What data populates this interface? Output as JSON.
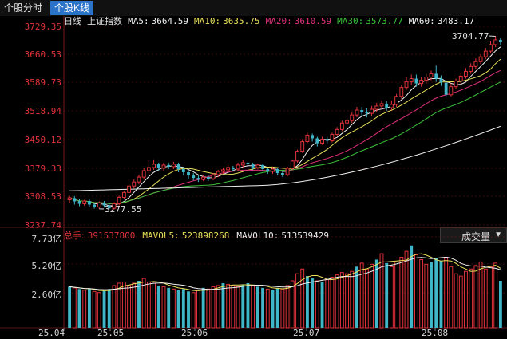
{
  "tabs": [
    {
      "label": "个股分时",
      "active": false
    },
    {
      "label": "个股K线",
      "active": true
    }
  ],
  "legend": {
    "period": "日线",
    "index_name": "上证指数",
    "ma5_label": "MA5:",
    "ma5_value": "3664.59",
    "ma10_label": "MA10:",
    "ma10_value": "3635.75",
    "ma20_label": "MA20:",
    "ma20_value": "3610.59",
    "ma30_label": "MA30:",
    "ma30_value": "3573.77",
    "ma60_label": "MA60:",
    "ma60_value": "3483.17"
  },
  "colors": {
    "up": "#e0323a",
    "down": "#3fb7c9",
    "ma5": "#f0f0f0",
    "ma10": "#e8e05a",
    "ma20": "#e0307a",
    "ma30": "#3cc13c",
    "ma60": "#f2f2f2",
    "grid": "#7a1a1a"
  },
  "price_axis": [
    "3729.35",
    "3660.53",
    "3589.73",
    "3518.94",
    "3450.12",
    "3379.33",
    "3308.53",
    "3237.74"
  ],
  "volume_axis": [
    "7.73亿",
    "5.20亿",
    "2.60亿"
  ],
  "date_axis": [
    "25.04",
    "25.05",
    "25.06",
    "25.07",
    "25.08"
  ],
  "annotations": {
    "high": "3704.77",
    "low": "3277.55"
  },
  "volume_legend": {
    "total_label": "总手:",
    "total_value": "391537800",
    "mavol5_label": "MAVOL5:",
    "mavol5_value": "523898268",
    "mavol10_label": "MAVOL10:",
    "mavol10_value": "513539429"
  },
  "indicator_select": {
    "label": "成交量"
  },
  "chart_data": {
    "type": "candlestick",
    "ylim": [
      3237.74,
      3729.35
    ],
    "candles": [
      [
        3300,
        3305,
        3292,
        3310
      ],
      [
        3304,
        3296,
        3288,
        3309
      ],
      [
        3296,
        3290,
        3284,
        3302
      ],
      [
        3290,
        3297,
        3285,
        3300
      ],
      [
        3297,
        3288,
        3282,
        3301
      ],
      [
        3288,
        3282,
        3278,
        3292
      ],
      [
        3282,
        3292,
        3277.55,
        3296
      ],
      [
        3292,
        3286,
        3281,
        3297
      ],
      [
        3286,
        3279,
        3277.55,
        3290
      ],
      [
        3279,
        3290,
        3276,
        3294
      ],
      [
        3290,
        3306,
        3286,
        3310
      ],
      [
        3306,
        3318,
        3302,
        3322
      ],
      [
        3318,
        3334,
        3314,
        3338
      ],
      [
        3334,
        3344,
        3328,
        3350
      ],
      [
        3344,
        3356,
        3338,
        3362
      ],
      [
        3356,
        3372,
        3350,
        3378
      ],
      [
        3372,
        3380,
        3366,
        3398
      ],
      [
        3380,
        3388,
        3374,
        3400
      ],
      [
        3388,
        3378,
        3372,
        3392
      ],
      [
        3378,
        3386,
        3372,
        3392
      ],
      [
        3386,
        3382,
        3376,
        3392
      ],
      [
        3382,
        3388,
        3376,
        3394
      ],
      [
        3388,
        3376,
        3368,
        3392
      ],
      [
        3376,
        3368,
        3360,
        3382
      ],
      [
        3368,
        3360,
        3352,
        3374
      ],
      [
        3360,
        3354,
        3348,
        3366
      ],
      [
        3354,
        3350,
        3344,
        3360
      ],
      [
        3350,
        3356,
        3346,
        3362
      ],
      [
        3356,
        3352,
        3346,
        3362
      ],
      [
        3352,
        3362,
        3348,
        3366
      ],
      [
        3362,
        3370,
        3356,
        3374
      ],
      [
        3370,
        3374,
        3364,
        3380
      ],
      [
        3374,
        3380,
        3368,
        3386
      ],
      [
        3380,
        3376,
        3370,
        3384
      ],
      [
        3376,
        3386,
        3372,
        3392
      ],
      [
        3386,
        3392,
        3380,
        3398
      ],
      [
        3392,
        3388,
        3382,
        3396
      ],
      [
        3388,
        3380,
        3374,
        3392
      ],
      [
        3380,
        3386,
        3376,
        3390
      ],
      [
        3386,
        3376,
        3370,
        3390
      ],
      [
        3376,
        3370,
        3364,
        3380
      ],
      [
        3370,
        3376,
        3364,
        3382
      ],
      [
        3376,
        3366,
        3360,
        3380
      ],
      [
        3366,
        3362,
        3356,
        3370
      ],
      [
        3362,
        3378,
        3358,
        3382
      ],
      [
        3378,
        3396,
        3374,
        3400
      ],
      [
        3396,
        3420,
        3392,
        3424
      ],
      [
        3420,
        3444,
        3416,
        3450
      ],
      [
        3444,
        3460,
        3440,
        3466
      ],
      [
        3460,
        3452,
        3444,
        3464
      ],
      [
        3452,
        3440,
        3432,
        3456
      ],
      [
        3440,
        3450,
        3436,
        3456
      ],
      [
        3450,
        3446,
        3440,
        3456
      ],
      [
        3446,
        3462,
        3442,
        3466
      ],
      [
        3462,
        3474,
        3458,
        3480
      ],
      [
        3474,
        3490,
        3470,
        3496
      ],
      [
        3490,
        3496,
        3484,
        3502
      ],
      [
        3496,
        3510,
        3490,
        3516
      ],
      [
        3510,
        3522,
        3504,
        3530
      ],
      [
        3522,
        3516,
        3508,
        3530
      ],
      [
        3516,
        3514,
        3504,
        3526
      ],
      [
        3514,
        3524,
        3508,
        3532
      ],
      [
        3524,
        3532,
        3516,
        3540
      ],
      [
        3532,
        3538,
        3524,
        3546
      ],
      [
        3538,
        3528,
        3520,
        3544
      ],
      [
        3528,
        3536,
        3522,
        3546
      ],
      [
        3536,
        3556,
        3530,
        3562
      ],
      [
        3556,
        3578,
        3550,
        3584
      ],
      [
        3578,
        3592,
        3572,
        3604
      ],
      [
        3592,
        3600,
        3584,
        3610
      ],
      [
        3600,
        3588,
        3580,
        3610
      ],
      [
        3588,
        3596,
        3580,
        3604
      ],
      [
        3596,
        3604,
        3588,
        3612
      ],
      [
        3604,
        3612,
        3596,
        3620
      ],
      [
        3612,
        3600,
        3592,
        3632
      ],
      [
        3600,
        3590,
        3582,
        3608
      ],
      [
        3590,
        3560,
        3554,
        3596
      ],
      [
        3560,
        3580,
        3556,
        3588
      ],
      [
        3580,
        3594,
        3574,
        3600
      ],
      [
        3594,
        3606,
        3588,
        3614
      ],
      [
        3606,
        3618,
        3600,
        3626
      ],
      [
        3618,
        3630,
        3612,
        3638
      ],
      [
        3630,
        3642,
        3624,
        3650
      ],
      [
        3642,
        3654,
        3636,
        3660
      ],
      [
        3654,
        3668,
        3648,
        3676
      ],
      [
        3668,
        3684,
        3662,
        3692
      ],
      [
        3684,
        3696,
        3678,
        3704.77
      ],
      [
        3696,
        3690,
        3684,
        3700
      ]
    ],
    "volume_ylim": [
      0,
      7.73
    ],
    "volumes": [
      3.5,
      3.4,
      3.3,
      3.2,
      3.3,
      3.1,
      3.0,
      3.2,
      3.3,
      3.6,
      3.8,
      3.9,
      3.6,
      3.8,
      4.0,
      4.2,
      3.9,
      3.8,
      3.6,
      3.5,
      3.4,
      3.3,
      3.2,
      3.3,
      3.1,
      3.0,
      3.2,
      3.4,
      3.3,
      3.5,
      3.6,
      3.8,
      3.7,
      3.6,
      3.5,
      3.7,
      3.8,
      3.6,
      3.5,
      3.4,
      3.3,
      3.2,
      3.4,
      3.3,
      3.6,
      4.0,
      4.6,
      5.0,
      4.4,
      4.2,
      4.0,
      3.9,
      4.1,
      4.3,
      4.5,
      4.7,
      4.6,
      4.8,
      5.2,
      5.5,
      5.0,
      5.4,
      5.8,
      6.3,
      5.5,
      5.2,
      5.6,
      6.0,
      6.5,
      7.0,
      6.2,
      5.8,
      5.4,
      5.6,
      5.9,
      5.7,
      6.0,
      5.2,
      4.6,
      4.4,
      4.8,
      5.0,
      5.3,
      5.6,
      5.0,
      5.2,
      5.5,
      4.0
    ],
    "volume_up": [
      false,
      true,
      false,
      true,
      false,
      true,
      true,
      false,
      false,
      true,
      true,
      true,
      true,
      true,
      false,
      true,
      true,
      true,
      false,
      true,
      false,
      true,
      false,
      false,
      false,
      true,
      true,
      false,
      true,
      true,
      true,
      false,
      true,
      true,
      true,
      false,
      false,
      true,
      false,
      false,
      true,
      false,
      false,
      true,
      true,
      true,
      true,
      true,
      false,
      false,
      true,
      false,
      true,
      true,
      true,
      true,
      true,
      true,
      false,
      true,
      true,
      true,
      false,
      true,
      false,
      true,
      true,
      true,
      true,
      false,
      true,
      true,
      true,
      false,
      false,
      false,
      true,
      true,
      true,
      true,
      true,
      true,
      true,
      true,
      true,
      true,
      true,
      false
    ],
    "x_tick_labels": [
      "25.04",
      "25.05",
      "25.06",
      "25.07",
      "25.08"
    ]
  }
}
